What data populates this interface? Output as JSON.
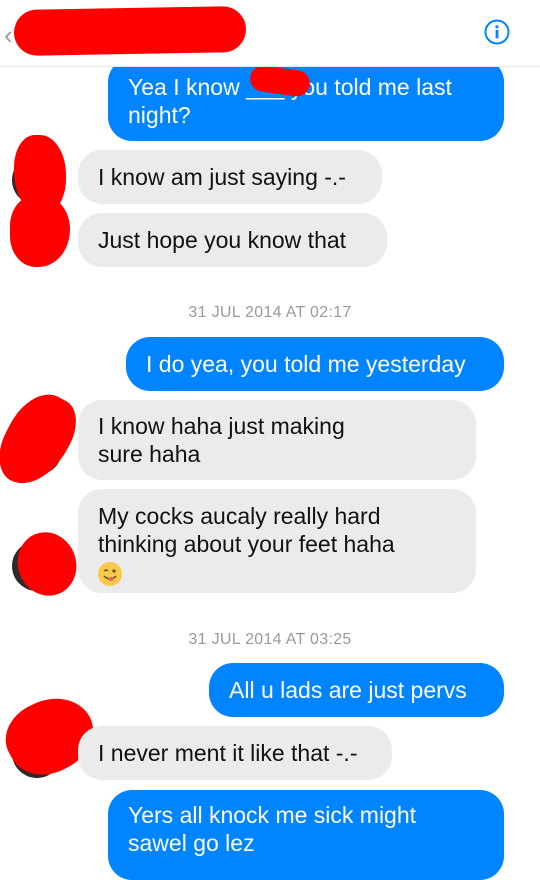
{
  "header": {
    "back_icon": "chevron-left-icon",
    "contact_name": "",
    "info_icon": "info-icon",
    "accent": "#0084ff"
  },
  "messages": {
    "m1": "Yea I know ___ you told me last night?",
    "m2": "I know am just saying -.-",
    "m3": "Just hope you know that",
    "ts1": "31 JUL 2014 AT 02:17",
    "m4": "I do yea, you told me yesterday",
    "m5": "I know haha just making sure haha",
    "m6": "My cocks aucaly really hard thinking about your feet haha",
    "ts2": "31 JUL 2014 AT 03:25",
    "m7": "All u lads are just pervs",
    "m8": "I never ment it like that -.-",
    "m9": "Yers all knock me sick might sawel go lez"
  },
  "colors": {
    "outgoing_bubble": "#0084ff",
    "incoming_bubble": "#ebebeb",
    "timestamp": "#9a9a9a",
    "redaction": "#ff0000"
  }
}
